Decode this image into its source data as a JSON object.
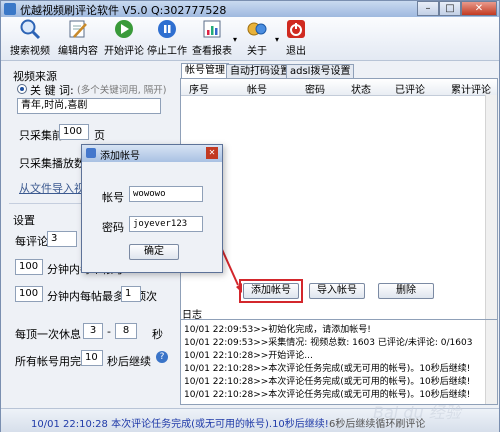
{
  "window": {
    "title": "优越视频刷评论软件 V5.0  Q:302777528",
    "minimize_glyph": "–",
    "maximize_glyph": "□",
    "close_glyph": "✕"
  },
  "toolbar": {
    "items": [
      {
        "label": "搜索视频",
        "icon": "magnifier-icon"
      },
      {
        "label": "编辑内容",
        "icon": "edit-icon"
      },
      {
        "label": "开始评论",
        "icon": "play-icon"
      },
      {
        "label": "停止工作",
        "icon": "stop-icon"
      },
      {
        "label": "查看报表",
        "icon": "report-icon"
      },
      {
        "label": "关于",
        "icon": "about-icon"
      },
      {
        "label": "退出",
        "icon": "power-icon"
      }
    ],
    "colors": {
      "play": "#3a9a3a",
      "stop": "#2f6fd0",
      "power": "#d02a20"
    }
  },
  "left": {
    "video_source_label": "视频来源",
    "keyword_label": "关 键 词:",
    "keyword_hint": "(多个关键词用, 隔开)",
    "keyword_value": "青年,时尚,喜剧",
    "collect_prefix": "只采集前",
    "collect_value": "100",
    "collect_suffix": "页",
    "play_count_label": "只采集播放数>=",
    "import_link": "从文件导入视频",
    "settings_label": "设置",
    "per_comment_label": "每评论",
    "per_comment_value": "3",
    "row1_value": "100",
    "row1_text": "分钟内每个帐号",
    "row2_value": "100",
    "row2_text": "分钟内每帖最多被顶",
    "row2_value2": "1",
    "row2_suffix": "次",
    "rest_label": "每顶一次休息",
    "rest_min": "3",
    "rest_dash": "-",
    "rest_max": "8",
    "rest_unit": "秒",
    "all_done_label": "所有帐号用完",
    "all_done_value": "10",
    "all_done_suffix": "秒后继续",
    "help_glyph": "?"
  },
  "tabs": [
    {
      "label": "帐号管理",
      "active": true
    },
    {
      "label": "自动打码设置",
      "active": false
    },
    {
      "label": "adsl拨号设置",
      "active": false
    }
  ],
  "account_table": {
    "columns": [
      "序号",
      "帐号",
      "密码",
      "状态",
      "已评论",
      "累计评论"
    ],
    "rows": []
  },
  "buttons": {
    "add": "添加帐号",
    "import": "导入帐号",
    "delete": "删除"
  },
  "log": {
    "title": "日志",
    "lines": [
      "10/01 22:09:53>>初始化完成，请添加帐号!",
      "10/01 22:09:53>>采集情况: 视频总数: 1603  已评论/未评论: 0/1603",
      "10/01 22:10:28>>开始评论...",
      "10/01 22:10:28>>本次评论任务完成(或无可用的帐号)。10秒后继续!",
      "10/01 22:10:28>>本次评论任务完成(或无可用的帐号)。10秒后继续!",
      "10/01 22:10:28>>本次评论任务完成(或无可用的帐号)。10秒后继续!"
    ]
  },
  "status": {
    "left": "10/01 22:10:28 本次评论任务完成(或无可用的帐号).10秒后继续!",
    "right": "6秒后继续循环刷评论"
  },
  "dialog": {
    "title": "添加帐号",
    "account_label": "帐号",
    "account_value": "wowowo",
    "password_label": "密码",
    "password_value": "joyever123",
    "confirm": "确定"
  },
  "watermark": "Bai du 经验",
  "highlight_color": "#d3272c"
}
